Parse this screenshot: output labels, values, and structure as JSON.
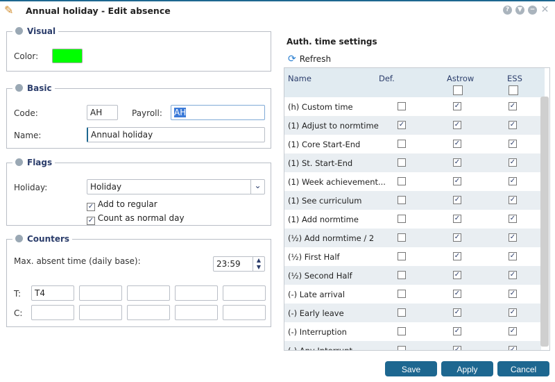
{
  "window": {
    "title": "Annual holiday - Edit absence",
    "icons": [
      "help-icon",
      "down-icon",
      "minimize-icon",
      "close-icon"
    ]
  },
  "visual": {
    "legend": "Visual",
    "color_label": "Color:",
    "color": "#00ff00"
  },
  "basic": {
    "legend": "Basic",
    "code_label": "Code:",
    "code": "AH",
    "payroll_label": "Payroll:",
    "payroll": "AH",
    "name_label": "Name:",
    "name": "Annual holiday"
  },
  "flags": {
    "legend": "Flags",
    "holiday_label": "Holiday:",
    "holiday": "Holiday",
    "add_to_regular": "Add to regular",
    "count_normal": "Count as normal day"
  },
  "counters": {
    "legend": "Counters",
    "max_label": "Max. absent time (daily base):",
    "max_value": "23:59",
    "t_label": "T:",
    "c_label": "C:",
    "t": [
      "T4",
      "",
      "",
      "",
      ""
    ],
    "c": [
      "",
      "",
      "",
      "",
      ""
    ]
  },
  "auth": {
    "title": "Auth. time settings",
    "refresh": "Refresh",
    "columns": [
      "Name",
      "Def.",
      "Astrow",
      "ESS"
    ],
    "rows": [
      {
        "name": "(h) Custom time",
        "def": false,
        "astrow": true,
        "ess": true
      },
      {
        "name": "(1) Adjust to normtime",
        "def": true,
        "astrow": true,
        "ess": true
      },
      {
        "name": "(1) Core Start-End",
        "def": false,
        "astrow": true,
        "ess": true
      },
      {
        "name": "(1) St. Start-End",
        "def": false,
        "astrow": true,
        "ess": true
      },
      {
        "name": "(1) Week achievement...",
        "def": false,
        "astrow": true,
        "ess": true
      },
      {
        "name": "(1) See curriculum",
        "def": false,
        "astrow": true,
        "ess": true
      },
      {
        "name": "(1) Add normtime",
        "def": false,
        "astrow": true,
        "ess": true
      },
      {
        "name": "(½) Add normtime / 2",
        "def": false,
        "astrow": true,
        "ess": true
      },
      {
        "name": "(½) First Half",
        "def": false,
        "astrow": true,
        "ess": true
      },
      {
        "name": "(½) Second Half",
        "def": false,
        "astrow": true,
        "ess": true
      },
      {
        "name": "(-) Late arrival",
        "def": false,
        "astrow": true,
        "ess": true
      },
      {
        "name": "(-) Early leave",
        "def": false,
        "astrow": true,
        "ess": true
      },
      {
        "name": "(-) Interruption",
        "def": false,
        "astrow": true,
        "ess": true
      },
      {
        "name": "(-) Any Interrupt",
        "def": false,
        "astrow": true,
        "ess": true
      }
    ]
  },
  "buttons": {
    "save": "Save",
    "apply": "Apply",
    "cancel": "Cancel"
  }
}
